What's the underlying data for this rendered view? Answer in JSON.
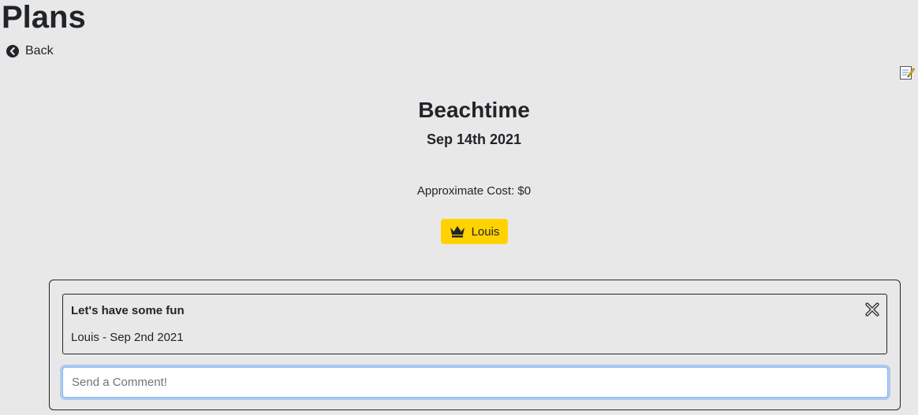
{
  "header": {
    "title": "Plans",
    "back_label": "Back"
  },
  "plan": {
    "name": "Beachtime",
    "date": "Sep 14th 2021",
    "cost": "Approximate Cost: $0",
    "owner": "Louis"
  },
  "comments": {
    "items": [
      {
        "text": "Let's have some fun",
        "meta": "Louis - Sep 2nd 2021"
      }
    ],
    "input": {
      "value": "",
      "placeholder": "Send a Comment!"
    }
  },
  "icons": {
    "back": "circle-chevron-left-icon",
    "edit": "edit-note-icon",
    "crown": "crown-icon",
    "delete": "close-x-icon"
  },
  "colors": {
    "background": "#e8e8e8",
    "badge": "#ffd200",
    "text": "#212529",
    "input_focus": "#86b7fe"
  }
}
